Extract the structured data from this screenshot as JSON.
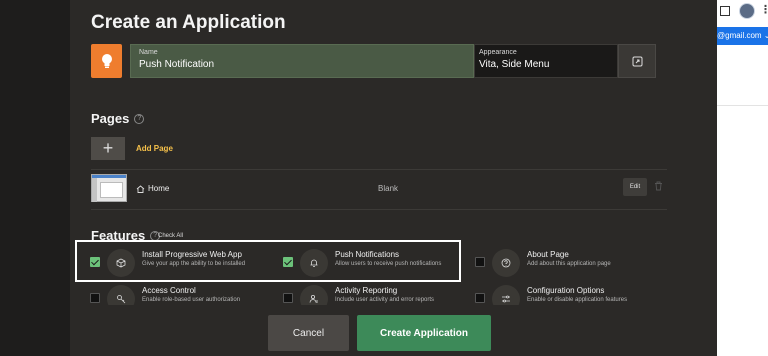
{
  "browser": {
    "account_text": "@gmail.com",
    "menu_dots": "⋮"
  },
  "dialog": {
    "title": "Create an Application",
    "name_label": "Name",
    "name_value": "Push Notification",
    "appearance_label": "Appearance",
    "appearance_value": "Vita, Side Menu"
  },
  "pages": {
    "title": "Pages",
    "add_label": "Add Page",
    "add_symbol": "+",
    "rows": [
      {
        "name": "Home",
        "type": "Blank",
        "edit_label": "Edit"
      }
    ]
  },
  "features": {
    "title": "Features",
    "check_all": "Check All",
    "items": [
      {
        "title": "Install Progressive Web App",
        "desc": "Give your app the ability to be installed",
        "checked": true,
        "icon": "cube-icon"
      },
      {
        "title": "Push Notifications",
        "desc": "Allow users to receive push notifications",
        "checked": true,
        "icon": "bell-icon"
      },
      {
        "title": "About Page",
        "desc": "Add about this application page",
        "checked": false,
        "icon": "question-icon"
      },
      {
        "title": "Access Control",
        "desc": "Enable role-based user authorization",
        "checked": false,
        "icon": "key-icon"
      },
      {
        "title": "Activity Reporting",
        "desc": "Include user activity and error reports",
        "checked": false,
        "icon": "user-chart-icon"
      },
      {
        "title": "Configuration Options",
        "desc": "Enable or disable application features",
        "checked": false,
        "icon": "sliders-icon"
      }
    ]
  },
  "footer": {
    "cancel_label": "Cancel",
    "create_label": "Create Application"
  },
  "colors": {
    "accent_orange": "#ef7d2e",
    "create_green": "#3d8a59",
    "checkbox_green": "#6cc27a",
    "add_page_yellow": "#f5c04a"
  }
}
